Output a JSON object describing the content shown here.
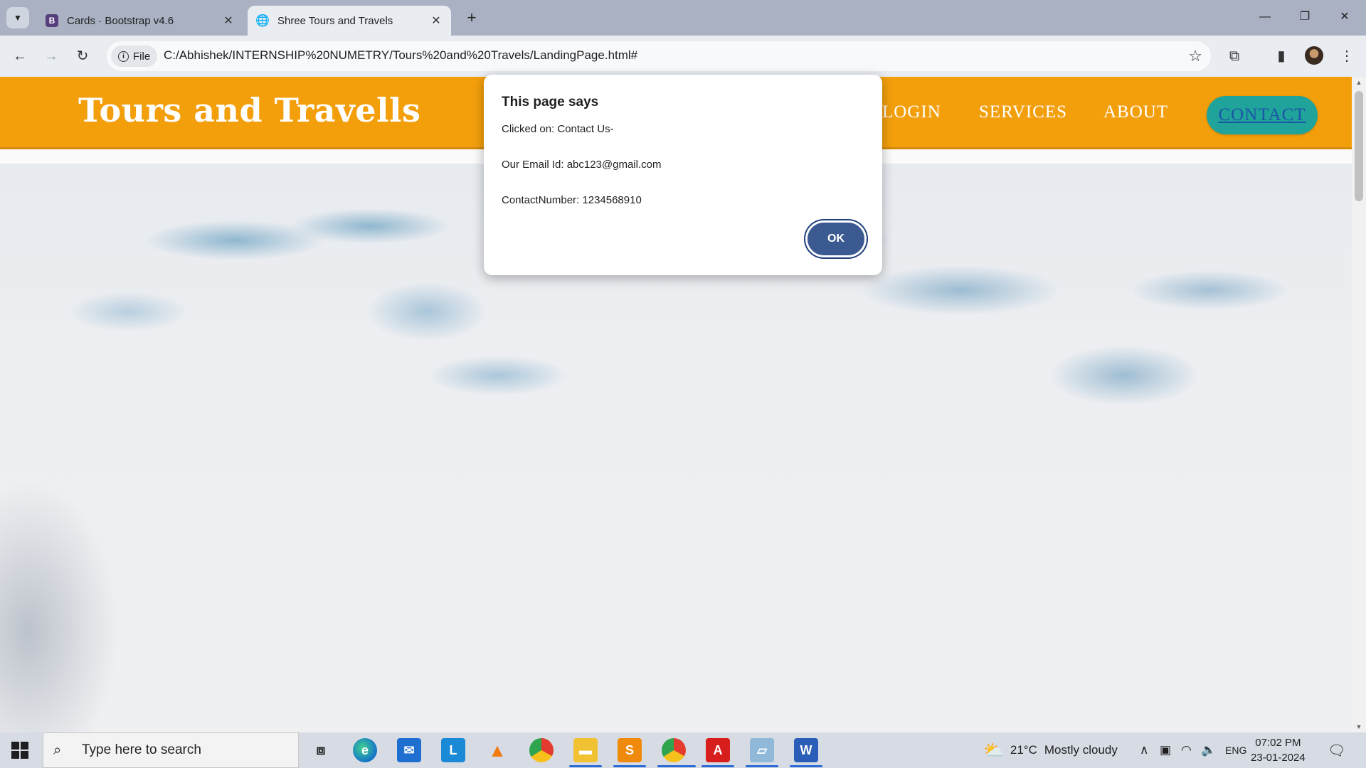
{
  "browser": {
    "tabs": [
      {
        "title": "Cards · Bootstrap v4.6",
        "favicon": "B",
        "active": false
      },
      {
        "title": "Shree Tours and Travels",
        "active": true
      }
    ],
    "new_tab": "+",
    "address": {
      "scheme_chip": "File",
      "url": "C:/Abhishek/INTERNSHIP%20NUMETRY/Tours%20and%20Travels/LandingPage.html#"
    }
  },
  "site": {
    "brand": "Tours and Travells",
    "nav": {
      "login": "LOGIN",
      "services": "SERVICES",
      "about": "ABOUT",
      "contact": "CONTACT"
    },
    "colors": {
      "nav_bg": "#f39f0c",
      "contact_bg": "#1fa39a"
    }
  },
  "dialog": {
    "title": "This page says",
    "line1": "Clicked on: Contact Us-",
    "line2": "Our Email Id: abc123@gmail.com",
    "line3": "ContactNumber: 1234568910",
    "ok": "OK"
  },
  "taskbar": {
    "search_placeholder": "Type here to search",
    "weather": {
      "temp": "21°C",
      "condition": "Mostly cloudy"
    },
    "language": "ENG",
    "time": "07:02 PM",
    "date": "23-01-2024",
    "pinned": [
      "task-view",
      "edge",
      "mail",
      "l-app",
      "vlc",
      "chrome",
      "file-explorer",
      "sublime-text",
      "chrome-profile",
      "acrobat",
      "notepad",
      "word"
    ]
  }
}
